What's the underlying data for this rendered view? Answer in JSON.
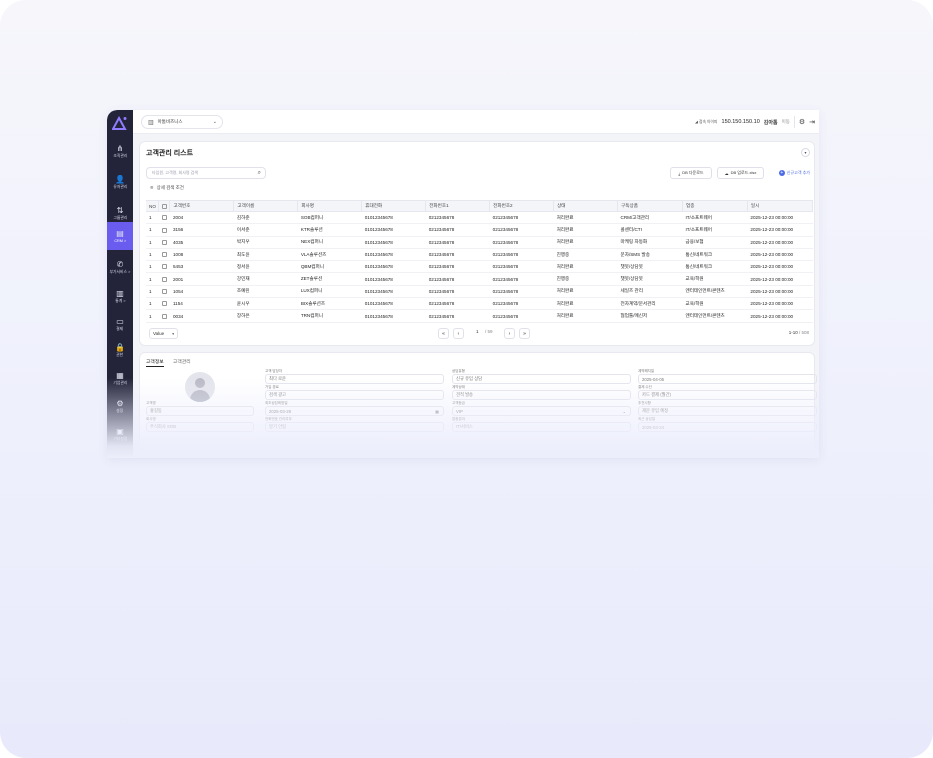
{
  "sidebar": {
    "items": [
      {
        "label": "조직관리",
        "icon": "org-icon",
        "glyph": "⋔",
        "active": false
      },
      {
        "label": "유저관리",
        "icon": "user-icon",
        "glyph": "👤",
        "active": false
      },
      {
        "label": "그룹관리",
        "icon": "group-icon",
        "glyph": "⇅",
        "active": false
      },
      {
        "label": "CRM >",
        "icon": "crm-icon",
        "glyph": "▤",
        "active": true
      },
      {
        "label": "부가서비스 >",
        "icon": "phone-icon",
        "glyph": "✆",
        "active": false
      },
      {
        "label": "통계 >",
        "icon": "stats-icon",
        "glyph": "▥",
        "active": false
      },
      {
        "label": "결제",
        "icon": "payment-icon",
        "glyph": "▭",
        "active": false
      },
      {
        "label": "권한",
        "icon": "lock-icon",
        "glyph": "🔒",
        "active": false
      },
      {
        "label": "기업관리",
        "icon": "company-icon",
        "glyph": "▦",
        "active": false
      },
      {
        "label": "설정",
        "icon": "gear-icon",
        "glyph": "⚙",
        "active": false
      },
      {
        "label": "기타설정",
        "icon": "etc-icon",
        "glyph": "▣",
        "active": false
      }
    ]
  },
  "header": {
    "org_name": "아톰비즈니스",
    "ip_label": "◢ 접속 아이피",
    "ip": "150.150.150.10",
    "user_name": "김아톰",
    "move_label": "이동"
  },
  "list": {
    "title": "고객관리 리스트",
    "search_placeholder": "타임원, 고객명, 회사명 검색",
    "advanced_search": "상세 검색 조건",
    "btn_download": "DB 다운로드",
    "btn_upload": "DB 업로드.xlsx",
    "btn_add": "신규고객 추가",
    "columns": [
      "NO",
      "",
      "고객번호",
      "고객이름",
      "회사명",
      "휴대전화",
      "전화번호1",
      "전화번호2",
      "상태",
      "구독상품",
      "업종",
      "일시"
    ],
    "rows": [
      [
        "1",
        "2004",
        "김하준",
        "SOB컴퍼니",
        "01012345678",
        "0212345678",
        "0212345678",
        "처리완료",
        "CRM/고객관리",
        "IT/소프트웨어",
        "2025-12-23 00:00:00"
      ],
      [
        "1",
        "3156",
        "이서준",
        "KTR솔루션",
        "01012345678",
        "0212345678",
        "0212345678",
        "처리완료",
        "콜센터/CTI",
        "IT/소프트웨어",
        "2025-12-23 00:00:00"
      ],
      [
        "1",
        "4035",
        "박지우",
        "NEX컴퍼니",
        "01012345678",
        "0212345678",
        "0212345678",
        "처리완료",
        "마케팅 자동화",
        "금융/보험",
        "2025-12-23 00:00:00"
      ],
      [
        "1",
        "1008",
        "최도윤",
        "VLA솔루션즈",
        "01012345678",
        "0212345678",
        "0212345678",
        "진행중",
        "문자/SMS 발송",
        "통신/네트워크",
        "2025-12-23 00:00:00"
      ],
      [
        "1",
        "5453",
        "정서윤",
        "QBM컴퍼니",
        "01012345678",
        "0212345678",
        "0212345678",
        "처리완료",
        "챗봇/상담봇",
        "통신/네트워크",
        "2025-12-23 00:00:00"
      ],
      [
        "1",
        "2001",
        "강민재",
        "ZET솔루션",
        "01012345678",
        "0212345678",
        "0212345678",
        "진행중",
        "챗봇/상담봇",
        "교육/학원",
        "2025-12-23 00:00:00"
      ],
      [
        "1",
        "1054",
        "조예린",
        "LUX컴퍼니",
        "01012345678",
        "0212345678",
        "0212345678",
        "처리완료",
        "세일즈 관리",
        "엔터테인먼트/콘텐츠",
        "2025-12-23 00:00:00"
      ],
      [
        "1",
        "1154",
        "윤시우",
        "BIX솔루션즈",
        "01012345678",
        "0212345678",
        "0212345678",
        "처리완료",
        "전자계약/문서관리",
        "교육/학원",
        "2025-12-23 00:00:00"
      ],
      [
        "1",
        "0034",
        "장하은",
        "TRN컴퍼니",
        "01012345678",
        "0212345678",
        "0212345678",
        "처리완료",
        "협업툴/메신저",
        "엔터테인먼트/콘텐츠",
        "2025-12-23 00:00:00"
      ]
    ],
    "per_page": "Value",
    "current_page": "1",
    "total_pages": "/ 59",
    "range": "1-10",
    "total": "/ 508"
  },
  "detail": {
    "tabs": [
      "고객정보",
      "고객관리"
    ],
    "fields": [
      {
        "label": "고객 담당자",
        "value": "최다 로운"
      },
      {
        "label": "상담유형",
        "value": "신규 유입 상담"
      },
      {
        "label": "계약해지일",
        "value": "2025-04-05"
      },
      {
        "label": "가입 경로",
        "value": "검색 광고"
      },
      {
        "label": "계약상태",
        "value": "견적 발송"
      },
      {
        "label": "결제 수단",
        "value": "카드 결제 (월간)"
      },
      {
        "label": "고객명",
        "value": "홍길동"
      },
      {
        "label": "최초상담희망일",
        "value": "2025-03-28"
      },
      {
        "label": "고객등급",
        "value": "VIP"
      },
      {
        "label": "추천사항",
        "value": "재문 유입 예정"
      },
      {
        "label": "회사명",
        "value": "주식회사 SOB"
      },
      {
        "label": "전화번호 관리여부",
        "value": "알기 안됨"
      },
      {
        "label": "업종분야",
        "value": "IT/서비스"
      },
      {
        "label": "최근 상담일",
        "value": "2025-03-24"
      }
    ]
  }
}
